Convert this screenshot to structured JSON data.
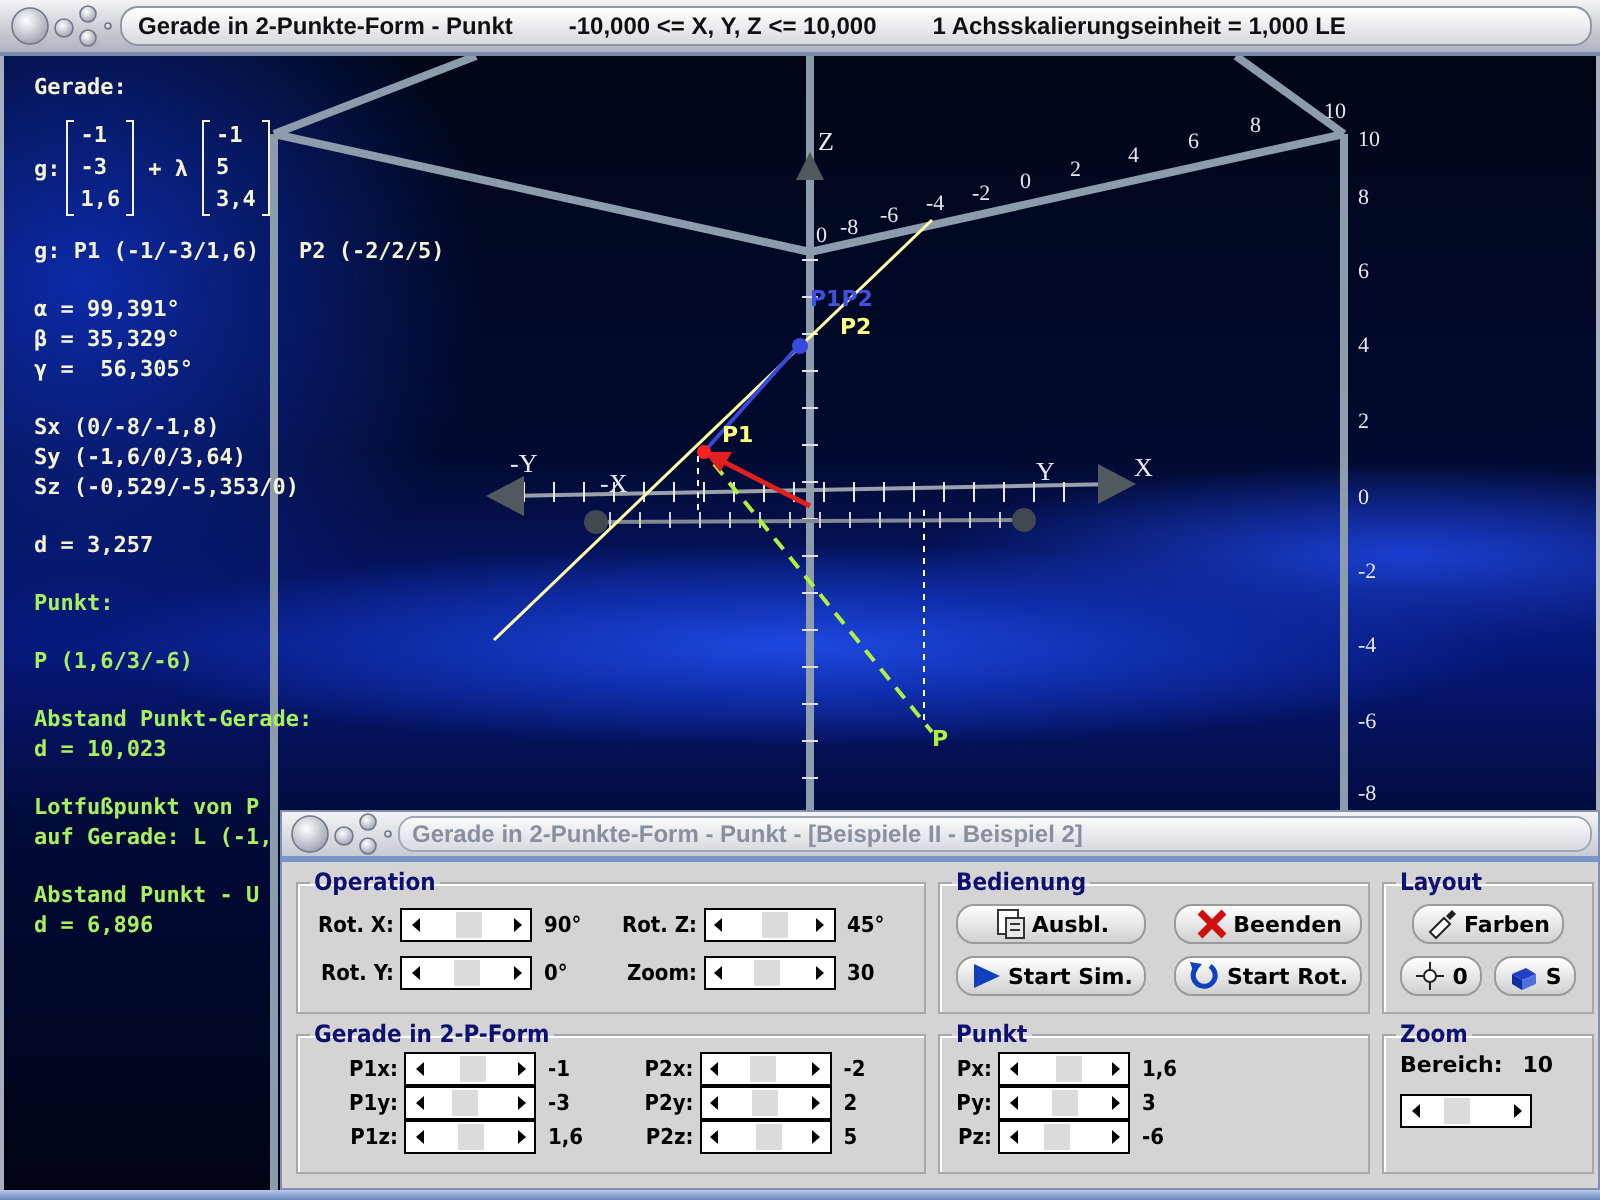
{
  "window": {
    "title": "Gerade in 2-Punkte-Form - Punkt",
    "range": "-10,000 <= X, Y, Z <= 10,000",
    "scale": "1 Achsskalierungseinheit = 1,000 LE"
  },
  "info": {
    "heading": "Gerade:",
    "equation": {
      "prefix": "g:",
      "support": [
        "-1",
        "-3",
        "1,6"
      ],
      "operator": "+ λ",
      "direction": [
        "-1",
        "5",
        "3,4"
      ]
    },
    "blocks": [
      {
        "kind": "line",
        "lines": [
          "g: P1 (-1/-3/1,6)   P2 (-2/2/5)"
        ]
      },
      {
        "kind": "line",
        "lines": [
          "α = 99,391°",
          "β = 35,329°",
          "γ =  56,305°"
        ]
      },
      {
        "kind": "line",
        "lines": [
          "Sx (0/-8/-1,8)",
          "Sy (-1,6/0/3,64)",
          "Sz (-0,529/-5,353/0)"
        ]
      },
      {
        "kind": "line",
        "lines": [
          "d = 3,257"
        ]
      },
      {
        "kind": "point",
        "lines": [
          "Punkt:"
        ]
      },
      {
        "kind": "point",
        "lines": [
          "P (1,6/3/-6)"
        ]
      },
      {
        "kind": "point",
        "lines": [
          "Abstand Punkt-Gerade:",
          "d = 10,023"
        ]
      },
      {
        "kind": "point",
        "lines": [
          "Lotfußpunkt von P",
          "auf Gerade: L (-1,"
        ]
      },
      {
        "kind": "point",
        "lines": [
          "Abstand Punkt - U",
          "d = 6,896"
        ]
      }
    ]
  },
  "scene": {
    "axis_labels": [
      "Z",
      "-Y",
      "X",
      "-X",
      "Y"
    ],
    "top_scale": [
      "0",
      "-8",
      "-6",
      "-4",
      "-2",
      "0",
      "2",
      "4",
      "6",
      "8",
      "10"
    ],
    "side_scale": [
      "10",
      "8",
      "6",
      "4",
      "2",
      "0",
      "-2",
      "-4",
      "-6",
      "-8"
    ],
    "point_labels": [
      {
        "text": "P1P2",
        "kind": "direction"
      },
      {
        "text": "P2",
        "kind": "line"
      },
      {
        "text": "P1",
        "kind": "line"
      },
      {
        "text": "P",
        "kind": "point"
      }
    ]
  },
  "dialog": {
    "title": "Gerade in 2-Punkte-Form - Punkt - [Beispiele II - Beispiel 2]",
    "operation": {
      "title": "Operation",
      "sliders": [
        {
          "label": "Rot. X:",
          "level": 0.55,
          "reading": "90°"
        },
        {
          "label": "Rot. Y:",
          "level": 0.5,
          "reading": "0°"
        },
        {
          "label": "Rot. Z:",
          "level": 0.6,
          "reading": "45°"
        },
        {
          "label": "Zoom:",
          "level": 0.45,
          "reading": "30"
        }
      ]
    },
    "line_form": {
      "title": "Gerade in 2-P-Form",
      "sliders": [
        {
          "label": "P1x:",
          "level": 0.55,
          "reading": "-1"
        },
        {
          "label": "P1y:",
          "level": 0.4,
          "reading": "-3"
        },
        {
          "label": "P1z:",
          "level": 0.5,
          "reading": "1,6"
        },
        {
          "label": "P2x:",
          "level": 0.45,
          "reading": "-2"
        },
        {
          "label": "P2y:",
          "level": 0.5,
          "reading": "2"
        },
        {
          "label": "P2z:",
          "level": 0.55,
          "reading": "5"
        }
      ]
    },
    "controls": {
      "title": "Bedienung",
      "buttons": [
        {
          "label": "Ausbl.",
          "kind": "hide"
        },
        {
          "label": "Beenden",
          "kind": "quit"
        },
        {
          "label": "Start Sim.",
          "kind": "play"
        },
        {
          "label": "Start Rot.",
          "kind": "rotate"
        }
      ]
    },
    "point": {
      "title": "Punkt",
      "sliders": [
        {
          "label": "Px:",
          "level": 0.6,
          "reading": "1,6"
        },
        {
          "label": "Py:",
          "level": 0.5,
          "reading": "3"
        },
        {
          "label": "Pz:",
          "level": 0.35,
          "reading": "-6"
        }
      ]
    },
    "layout": {
      "title": "Layout",
      "buttons": [
        {
          "label": "Farben",
          "kind": "colors"
        },
        {
          "label": "0",
          "kind": "origin"
        },
        {
          "label": "S",
          "kind": "solid"
        }
      ]
    },
    "zoom": {
      "title": "Zoom",
      "label": "Bereich:",
      "value": "10",
      "level": 0.3
    }
  }
}
